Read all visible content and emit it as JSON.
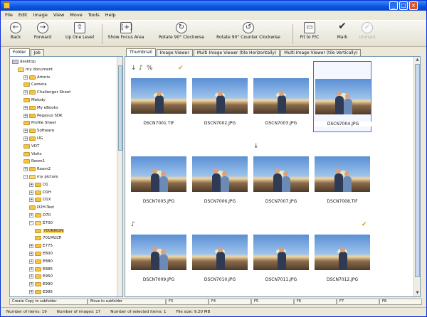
{
  "menu": [
    "File",
    "Edit",
    "Image",
    "View",
    "Move",
    "Tools",
    "Help"
  ],
  "window_controls": {
    "minimize": "_",
    "maximize": "□",
    "close": "×"
  },
  "toolbar": {
    "back": "Back",
    "forward": "Forward",
    "up": "Up One Level",
    "focus": "Show Focus Area",
    "rotate_cw": "Rotate 90° Clockwise",
    "rotate_ccw": "Rotate 90° Counter Clockwise",
    "fit": "Fit to P/C",
    "mark": "Mark",
    "unmark": "Unmark"
  },
  "left_tabs": [
    "Folder",
    "Job"
  ],
  "tree": [
    {
      "label": "desktop",
      "depth": 0,
      "type": "root"
    },
    {
      "label": "my document",
      "depth": 1,
      "type": "open"
    },
    {
      "label": "Artoris",
      "depth": 2,
      "type": "folder",
      "pm": "+"
    },
    {
      "label": "Camera",
      "depth": 2,
      "type": "folder"
    },
    {
      "label": "Challenger Sheet",
      "depth": 2,
      "type": "folder",
      "pm": "+"
    },
    {
      "label": "Melody",
      "depth": 2,
      "type": "folder"
    },
    {
      "label": "My eBooks",
      "depth": 2,
      "type": "folder",
      "pm": "+"
    },
    {
      "label": "Pegasus SDK",
      "depth": 2,
      "type": "folder",
      "pm": "+"
    },
    {
      "label": "Profile Sheet",
      "depth": 2,
      "type": "folder"
    },
    {
      "label": "Software",
      "depth": 2,
      "type": "folder",
      "pm": "+"
    },
    {
      "label": "UG",
      "depth": 2,
      "type": "folder",
      "pm": "+"
    },
    {
      "label": "VDT",
      "depth": 2,
      "type": "folder"
    },
    {
      "label": "Visits",
      "depth": 2,
      "type": "folder"
    },
    {
      "label": "Room1",
      "depth": 2,
      "type": "folder"
    },
    {
      "label": "Room2",
      "depth": 2,
      "type": "folder",
      "pm": "+"
    },
    {
      "label": "my picture",
      "depth": 2,
      "type": "open",
      "pm": "-"
    },
    {
      "label": "D1",
      "depth": 3,
      "type": "folder",
      "pm": "+"
    },
    {
      "label": "D1H",
      "depth": 3,
      "type": "folder",
      "pm": "+"
    },
    {
      "label": "D1X",
      "depth": 3,
      "type": "folder",
      "pm": "+"
    },
    {
      "label": "D2H-Test",
      "depth": 3,
      "type": "folder"
    },
    {
      "label": "D70",
      "depth": 3,
      "type": "folder",
      "pm": "+"
    },
    {
      "label": "E700",
      "depth": 3,
      "type": "open",
      "pm": "-"
    },
    {
      "label": "700NIKON",
      "depth": 4,
      "type": "folder",
      "sel": true
    },
    {
      "label": "701MULTI",
      "depth": 4,
      "type": "folder"
    },
    {
      "label": "E775",
      "depth": 3,
      "type": "folder",
      "pm": "+"
    },
    {
      "label": "E800",
      "depth": 3,
      "type": "folder",
      "pm": "+"
    },
    {
      "label": "E880",
      "depth": 3,
      "type": "folder",
      "pm": "+"
    },
    {
      "label": "E885",
      "depth": 3,
      "type": "folder",
      "pm": "+"
    },
    {
      "label": "E950",
      "depth": 3,
      "type": "folder",
      "pm": "+"
    },
    {
      "label": "E990",
      "depth": 3,
      "type": "folder",
      "pm": "+"
    },
    {
      "label": "E995",
      "depth": 3,
      "type": "folder",
      "pm": "+"
    }
  ],
  "right_tabs": [
    "Thumbnail",
    "Image Viewer",
    "Multi Image Viewer (tile Horizontally)",
    "Multi Image Viewer (tile Vertically)"
  ],
  "thumbnails": [
    {
      "caption": "DSCN7001.TIF",
      "marks": [
        "arrow",
        "note",
        "pct"
      ],
      "check": true,
      "scene": "single"
    },
    {
      "caption": "DSCN7002.JPG",
      "marks": [],
      "check": false,
      "scene": "single"
    },
    {
      "caption": "DSCN7003.JPG",
      "marks": [],
      "check": false,
      "scene": "single"
    },
    {
      "caption": "DSCN7004.JPG",
      "marks": [],
      "check": false,
      "scene": "couple",
      "selected": true
    },
    {
      "caption": "DSCN7005.JPG",
      "marks": [],
      "check": false,
      "scene": "couple"
    },
    {
      "caption": "DSCN7006.JPG",
      "marks": [],
      "check": false,
      "scene": "couple"
    },
    {
      "caption": "DSCN7007.JPG",
      "marks": [
        "arrow"
      ],
      "check": false,
      "scene": "couple"
    },
    {
      "caption": "DSCN7008.TIF",
      "marks": [],
      "check": false,
      "scene": "couple"
    },
    {
      "caption": "DSCN7009.JPG",
      "marks": [
        "note"
      ],
      "check": false,
      "scene": "couple"
    },
    {
      "caption": "DSCN7010.JPG",
      "marks": [],
      "check": false,
      "scene": "single"
    },
    {
      "caption": "DSCN7011.JPG",
      "marks": [],
      "check": false,
      "scene": "single"
    },
    {
      "caption": "DSCN7012.JPG",
      "marks": [],
      "check": true,
      "scene": "single"
    }
  ],
  "status_row": [
    "Create Copy to subfolder",
    "Move to subfolder",
    "F3",
    "F4",
    "F5",
    "F6",
    "F7",
    "F8"
  ],
  "status": {
    "items": "Number of items: 19",
    "images": "Number of images: 17",
    "selected": "Number of selected items: 1",
    "size": "File size: 9.20 MB"
  },
  "colors": {
    "accent": "#0a52e0",
    "selection": "#4a6ec8",
    "folder": "#f3c341",
    "mark": "#d4a015"
  }
}
